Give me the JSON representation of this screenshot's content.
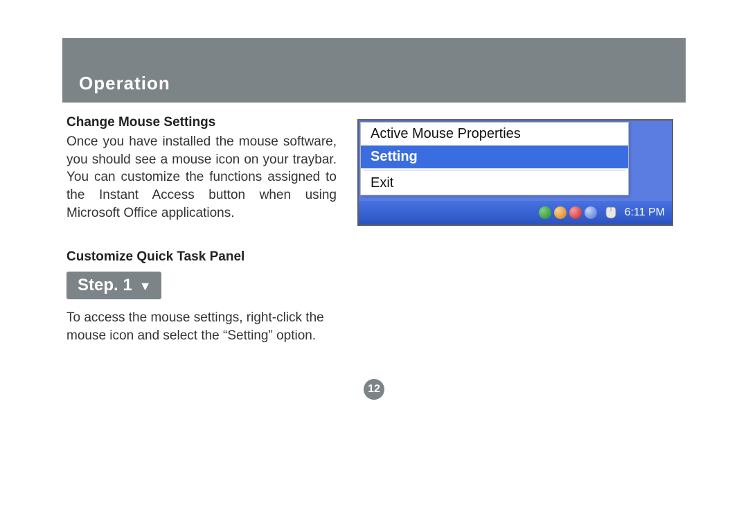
{
  "header": {
    "title": "Operation"
  },
  "section1": {
    "heading": "Change Mouse Settings",
    "body": "Once you have installed the mouse software, you should see a mouse icon on your traybar. You can customize the functions assigned to the Instant Access button when using Microsoft Office applications."
  },
  "section2": {
    "heading": "Customize Quick Task Panel",
    "step_label": "Step. 1",
    "body": "To access the mouse settings, right-click the mouse icon and select the “Setting” option."
  },
  "screenshot": {
    "menu": {
      "item1": "Active Mouse Properties",
      "item2_selected": "Setting",
      "item3": "Exit"
    },
    "taskbar": {
      "time": "6:11 PM"
    }
  },
  "page_number": "12"
}
